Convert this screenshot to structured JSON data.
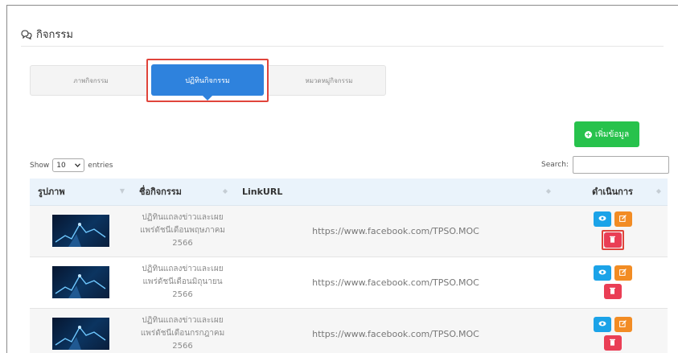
{
  "page": {
    "title": "กิจกรรม",
    "title_icon": "chat-bubbles-icon"
  },
  "tabs": [
    {
      "label": "ภาพกิจกรรม",
      "active": false
    },
    {
      "label": "ปฏิทินกิจกรรม",
      "active": true
    },
    {
      "label": "หมวดหมู่กิจกรรม",
      "active": false
    }
  ],
  "add_button": {
    "label": "เพิ่มข้อมูล",
    "icon": "plus-circle-icon",
    "color": "#27c24c"
  },
  "length_menu": {
    "prefix": "Show",
    "value": "10",
    "suffix": "entries"
  },
  "search": {
    "label": "Search:",
    "value": ""
  },
  "table": {
    "headers": [
      "รูปภาพ",
      "ชื่อกิจกรรม",
      "LinkURL",
      "ดำเนินการ"
    ],
    "rows": [
      {
        "name": "ปฏิทินแถลงข่าวและเผยแพร่ดัชนีเดือนพฤษภาคม 2566",
        "link": "https://www.facebook.com/TPSO.MOC"
      },
      {
        "name": "ปฏิทินแถลงข่าวและเผยแพร่ดัชนีเดือนมิถุนายน 2566",
        "link": "https://www.facebook.com/TPSO.MOC"
      },
      {
        "name": "ปฏิทินแถลงข่าวและเผยแพร่ดัชนีเดือนกรกฎาคม 2566",
        "link": "https://www.facebook.com/TPSO.MOC"
      }
    ]
  },
  "colors": {
    "primary": "#2e82dd",
    "view": "#1ba3e8",
    "edit": "#f28c24",
    "delete": "#ea3e55",
    "highlight": "#e0443b"
  }
}
